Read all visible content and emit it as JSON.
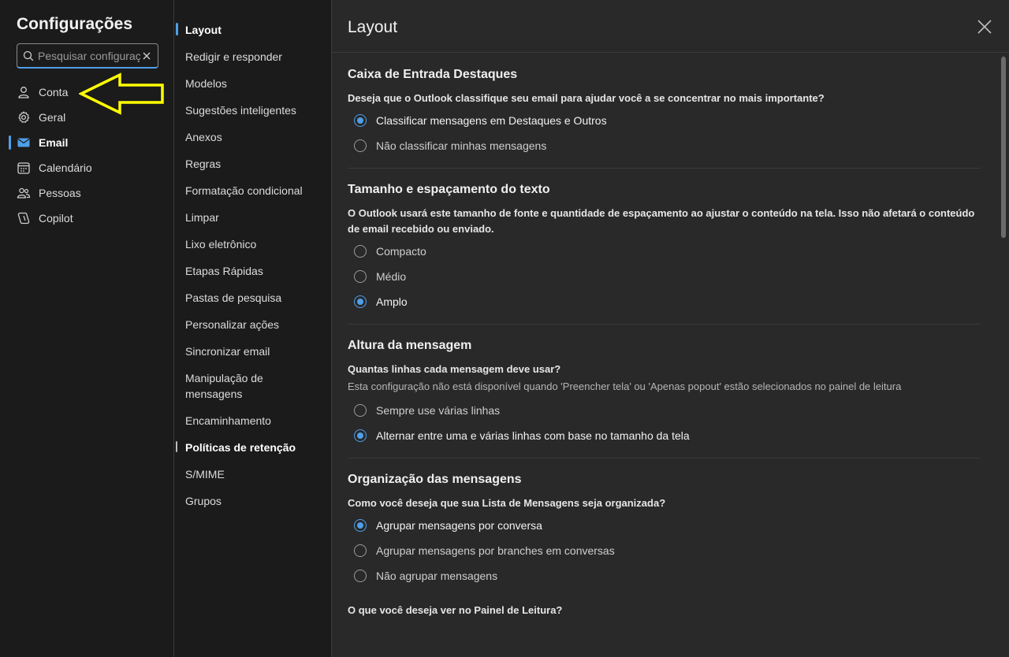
{
  "app": {
    "title": "Configurações"
  },
  "search": {
    "placeholder": "Pesquisar configurações"
  },
  "nav_left": [
    {
      "label": "Conta",
      "icon": "person-icon"
    },
    {
      "label": "Geral",
      "icon": "gear-icon"
    },
    {
      "label": "Email",
      "icon": "mail-icon"
    },
    {
      "label": "Calendário",
      "icon": "calendar-icon"
    },
    {
      "label": "Pessoas",
      "icon": "people-icon"
    },
    {
      "label": "Copilot",
      "icon": "copilot-icon"
    }
  ],
  "nav_mid": [
    "Layout",
    "Redigir e responder",
    "Modelos",
    "Sugestões inteligentes",
    "Anexos",
    "Regras",
    "Formatação condicional",
    "Limpar",
    "Lixo eletrônico",
    "Etapas Rápidas",
    "Pastas de pesquisa",
    "Personalizar ações",
    "Sincronizar email",
    "Manipulação de mensagens",
    "Encaminhamento",
    "Políticas de retenção",
    "S/MIME",
    "Grupos"
  ],
  "panel": {
    "title": "Layout",
    "sections": [
      {
        "heading": "Caixa de Entrada Destaques",
        "question": "Deseja que o Outlook classifique seu email para ajudar você a se concentrar no mais importante?",
        "options": [
          "Classificar mensagens em Destaques e Outros",
          "Não classificar minhas mensagens"
        ]
      },
      {
        "heading": "Tamanho e espaçamento do texto",
        "question": "O Outlook usará este tamanho de fonte e quantidade de espaçamento ao ajustar o conteúdo na tela. Isso não afetará o conteúdo de email recebido ou enviado.",
        "options": [
          "Compacto",
          "Médio",
          "Amplo"
        ]
      },
      {
        "heading": "Altura da mensagem",
        "question": "Quantas linhas cada mensagem deve usar?",
        "hint": "Esta configuração não está disponível quando 'Preencher tela' ou 'Apenas popout' estão selecionados no painel de leitura",
        "options": [
          "Sempre use várias linhas",
          "Alternar entre uma e várias linhas com base no tamanho da tela"
        ]
      },
      {
        "heading": "Organização das mensagens",
        "question": "Como você deseja que sua Lista de Mensagens seja organizada?",
        "options": [
          "Agrupar mensagens por conversa",
          "Agrupar mensagens por branches em conversas",
          "Não agrupar mensagens"
        ]
      }
    ],
    "trailing_question": "O que você deseja ver no Painel de Leitura?"
  },
  "colors": {
    "accent": "#4f9fe8",
    "annotation_arrow": "#ffff00"
  }
}
